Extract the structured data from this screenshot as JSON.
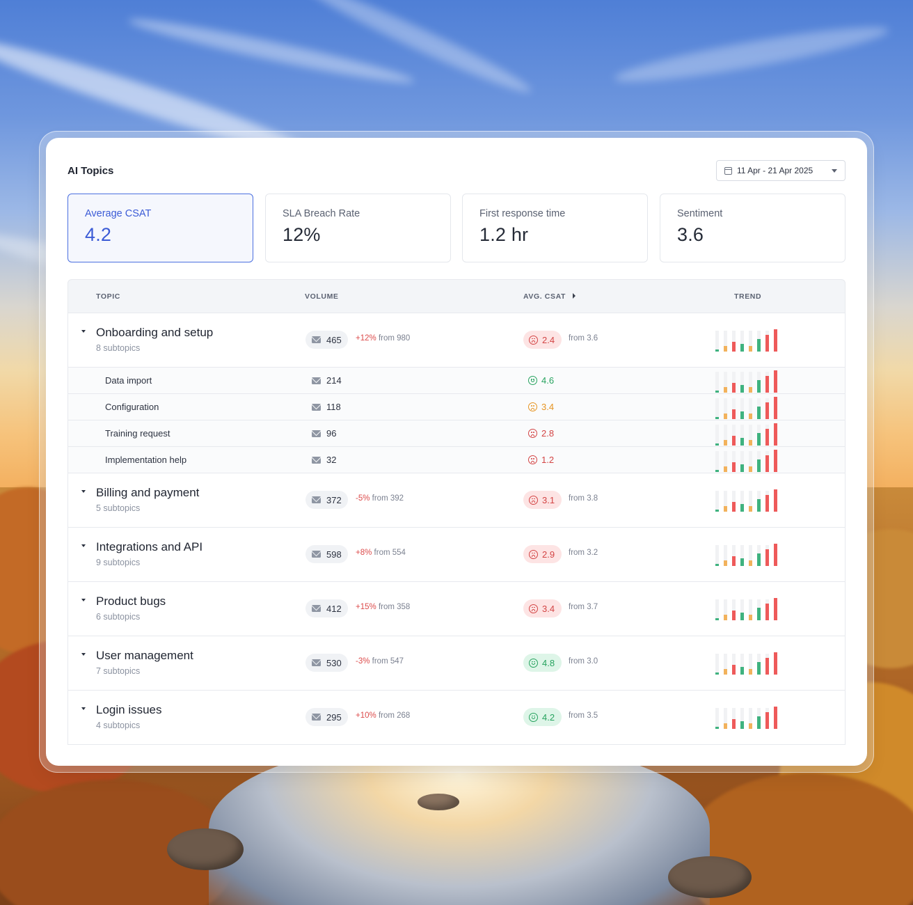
{
  "title": "AI Topics",
  "date_range": "11 Apr - 21 Apr 2025",
  "kpis": [
    {
      "label": "Average CSAT",
      "value": "4.2",
      "active": true
    },
    {
      "label": "SLA Breach Rate",
      "value": "12%"
    },
    {
      "label": "First response time",
      "value": "1.2 hr"
    },
    {
      "label": "Sentiment",
      "value": "3.6"
    }
  ],
  "table": {
    "headers": {
      "topic": "TOPIC",
      "volume": "VOLUME",
      "csat": "AVG. CSAT",
      "trend": "TREND"
    },
    "rows": [
      {
        "kind": "topic",
        "name": "Onboarding and setup",
        "subtopics": "8 subtopics",
        "volume": "465",
        "delta_pct": "+12%",
        "delta_from": "from 980",
        "csat": "2.4",
        "csat_status": "bad",
        "csat_from": "from 3.6"
      },
      {
        "kind": "subtopic",
        "name": "Data import",
        "volume": "214",
        "csat": "4.6",
        "csat_status": "good"
      },
      {
        "kind": "subtopic",
        "name": "Configuration",
        "volume": "118",
        "csat": "3.4",
        "csat_status": "warn"
      },
      {
        "kind": "subtopic",
        "name": "Training request",
        "volume": "96",
        "csat": "2.8",
        "csat_status": "bad"
      },
      {
        "kind": "subtopic",
        "name": "Implementation help",
        "volume": "32",
        "csat": "1.2",
        "csat_status": "bad"
      },
      {
        "kind": "topic",
        "name": "Billing and payment",
        "subtopics": "5 subtopics",
        "volume": "372",
        "delta_pct": "-5%",
        "delta_from": "from 392",
        "csat": "3.1",
        "csat_status": "bad",
        "csat_from": "from 3.8"
      },
      {
        "kind": "topic",
        "name": "Integrations and API",
        "subtopics": "9 subtopics",
        "volume": "598",
        "delta_pct": "+8%",
        "delta_from": "from 554",
        "csat": "2.9",
        "csat_status": "bad",
        "csat_from": "from 3.2"
      },
      {
        "kind": "topic",
        "name": "Product bugs",
        "subtopics": "6 subtopics",
        "volume": "412",
        "delta_pct": "+15%",
        "delta_from": "from 358",
        "csat": "3.4",
        "csat_status": "bad",
        "csat_from": "from 3.7"
      },
      {
        "kind": "topic",
        "name": "User management",
        "subtopics": "7 subtopics",
        "volume": "530",
        "delta_pct": "-3%",
        "delta_from": "from 547",
        "csat": "4.8",
        "csat_status": "good",
        "csat_from": "from 3.0"
      },
      {
        "kind": "topic",
        "name": "Login issues",
        "subtopics": "4 subtopics",
        "volume": "295",
        "delta_pct": "+10%",
        "delta_from": "from 268",
        "csat": "4.2",
        "csat_status": "good",
        "csat_from": "from 3.5"
      }
    ]
  },
  "trend_levels": [
    0.1,
    0.25,
    0.45,
    0.35,
    0.25,
    0.55,
    0.75,
    1.0
  ],
  "trend_colors": [
    "#3fb27f",
    "#f2b25c",
    "#ee5a5a",
    "#3fb27f",
    "#f2b25c",
    "#3fb27f",
    "#ee5a5a",
    "#ee5a5a"
  ],
  "colors": {
    "accent": "#3b5bd6",
    "bad": "#d34444",
    "good": "#27a35f",
    "warn": "#e69422"
  }
}
